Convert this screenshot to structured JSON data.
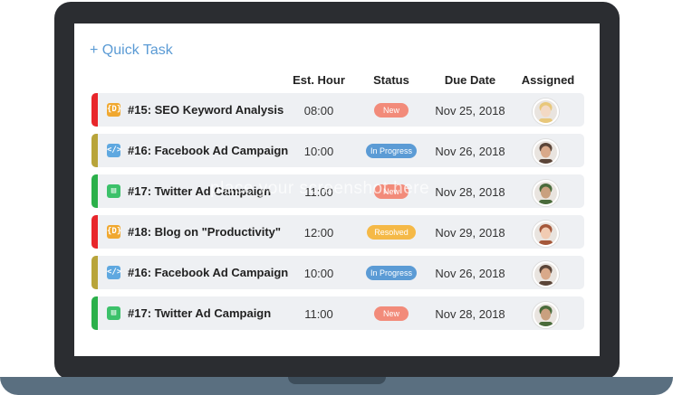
{
  "quick_task": "+ Quick Task",
  "columns": {
    "est_hour": "Est. Hour",
    "status": "Status",
    "due_date": "Due Date",
    "assigned": "Assigned"
  },
  "tasks": [
    {
      "title": "#15: SEO Keyword Analysis",
      "hour": "08:00",
      "status": "New",
      "due": "Nov 25, 2018",
      "stripe": "#e8262b",
      "icon": "bracket-icon",
      "icon_color": "#f0a830",
      "status_color": "#f28b7a",
      "avatar": "female-blonde-avatar"
    },
    {
      "title": "#16: Facebook Ad Campaign",
      "hour": "10:00",
      "status": "In Progress",
      "due": "Nov 26, 2018",
      "stripe": "#b8a43a",
      "icon": "code-icon",
      "icon_color": "#5fa8e0",
      "status_color": "#5b9bd5",
      "avatar": "male-bald-avatar"
    },
    {
      "title": "#17: Twitter Ad Campaign",
      "hour": "11:00",
      "status": "New",
      "due": "Nov 28, 2018",
      "stripe": "#2bb04a",
      "icon": "document-icon",
      "icon_color": "#3cc16a",
      "status_color": "#f28b7a",
      "avatar": "male-smiling-avatar"
    },
    {
      "title": "#18: Blog on \"Productivity\"",
      "hour": "12:00",
      "status": "Resolved",
      "due": "Nov 29, 2018",
      "stripe": "#e8262b",
      "icon": "bracket-icon",
      "icon_color": "#f0a830",
      "status_color": "#f5b947",
      "avatar": "female-redhead-avatar"
    },
    {
      "title": "#16: Facebook Ad Campaign",
      "hour": "10:00",
      "status": "In Progress",
      "due": "Nov 26, 2018",
      "stripe": "#b8a43a",
      "icon": "code-icon",
      "icon_color": "#5fa8e0",
      "status_color": "#5b9bd5",
      "avatar": "male-bald-avatar"
    },
    {
      "title": "#17: Twitter Ad Campaign",
      "hour": "11:00",
      "status": "New",
      "due": "Nov 28, 2018",
      "stripe": "#2bb04a",
      "icon": "document-icon",
      "icon_color": "#3cc16a",
      "status_color": "#f28b7a",
      "avatar": "male-smiling-avatar"
    }
  ],
  "watermark": "place your screenshot here"
}
